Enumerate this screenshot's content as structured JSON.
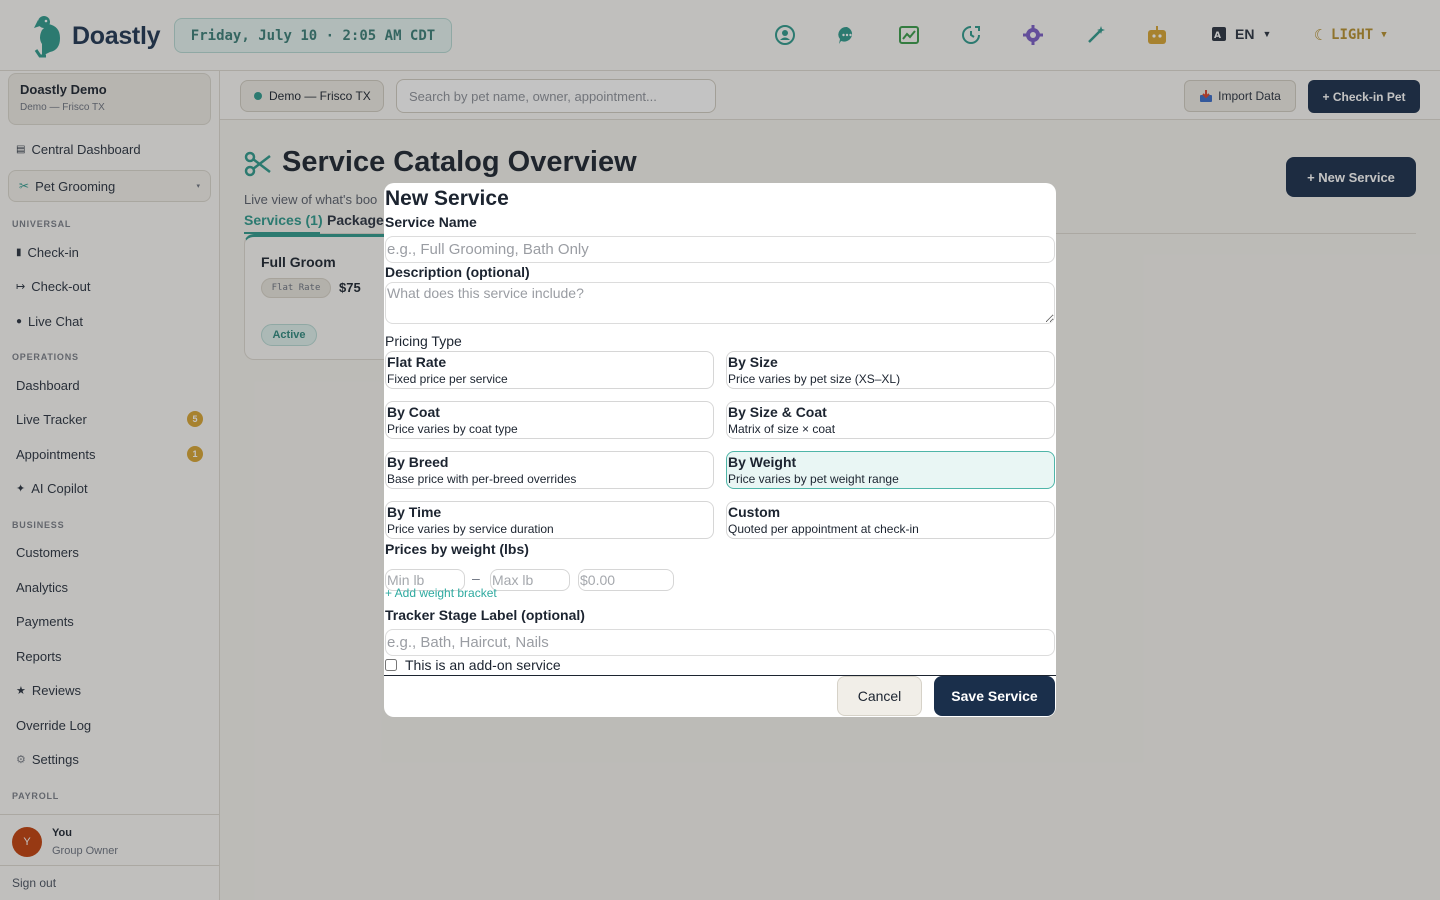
{
  "app": {
    "name": "Doastly",
    "datetime": "Friday, July 10 · 2:05 AM CDT"
  },
  "topbar": {
    "lang": "EN",
    "theme": "LIGHT"
  },
  "org": {
    "name": "Doastly Demo",
    "sub": "Demo — Frisco TX"
  },
  "sidebar": {
    "central": "Central Dashboard",
    "module": "Pet Grooming",
    "sec_universal": "UNIVERSAL",
    "checkin": "Check-in",
    "checkout": "Check-out",
    "livechat": "Live Chat",
    "sec_operations": "OPERATIONS",
    "dashboard": "Dashboard",
    "tracker": "Live Tracker",
    "tracker_badge": "5",
    "appointments": "Appointments",
    "appointments_badge": "1",
    "copilot": "AI Copilot",
    "sec_business": "BUSINESS",
    "customers": "Customers",
    "analytics": "Analytics",
    "payments": "Payments",
    "reports": "Reports",
    "reviews": "Reviews",
    "override": "Override Log",
    "settings": "Settings",
    "sec_payroll": "PAYROLL"
  },
  "user": {
    "initial": "Y",
    "name": "You",
    "role": "Group Owner",
    "signout": "Sign out"
  },
  "subbar": {
    "location": "Demo — Frisco TX",
    "search_placeholder": "Search by pet name, owner, appointment...",
    "import": "Import Data",
    "checkin": "+ Check-in Pet"
  },
  "page": {
    "title": "Service Catalog Overview",
    "subtitle": "Live view of what's boo",
    "tab_services": "Services (1)",
    "tab_packages": "Package",
    "new_service": "+ New Service"
  },
  "service_card": {
    "name": "Full Groom",
    "pricing": "Flat Rate",
    "price": "$75",
    "status": "Active"
  },
  "modal": {
    "title": "New Service",
    "name_label": "Service Name",
    "name_placeholder": "e.g., Full Grooming, Bath Only",
    "desc_label": "Description (optional)",
    "desc_placeholder": "What does this service include?",
    "pricing_label": "Pricing Type",
    "pricing_types": [
      {
        "name": "Flat Rate",
        "desc": "Fixed price per service"
      },
      {
        "name": "By Size",
        "desc": "Price varies by pet size (XS–XL)"
      },
      {
        "name": "By Coat",
        "desc": "Price varies by coat type"
      },
      {
        "name": "By Size & Coat",
        "desc": "Matrix of size × coat"
      },
      {
        "name": "By Breed",
        "desc": "Base price with per-breed overrides"
      },
      {
        "name": "By Weight",
        "desc": "Price varies by pet weight range"
      },
      {
        "name": "By Time",
        "desc": "Price varies by service duration"
      },
      {
        "name": "Custom",
        "desc": "Quoted per appointment at check-in"
      }
    ],
    "weight_label": "Prices by weight (lbs)",
    "min_placeholder": "Min lb",
    "dash": "–",
    "max_placeholder": "Max lb",
    "price_placeholder": "$0.00",
    "add_bracket": "+ Add weight bracket",
    "tracker_label": "Tracker Stage Label (optional)",
    "tracker_placeholder": "e.g., Bath, Haircut, Nails",
    "addon_label": "This is an add-on service",
    "cancel": "Cancel",
    "save": "Save Service"
  },
  "colors": {
    "brand": "#1a2f4b",
    "accent": "#2e9a8d",
    "warning": "#d8a532"
  }
}
